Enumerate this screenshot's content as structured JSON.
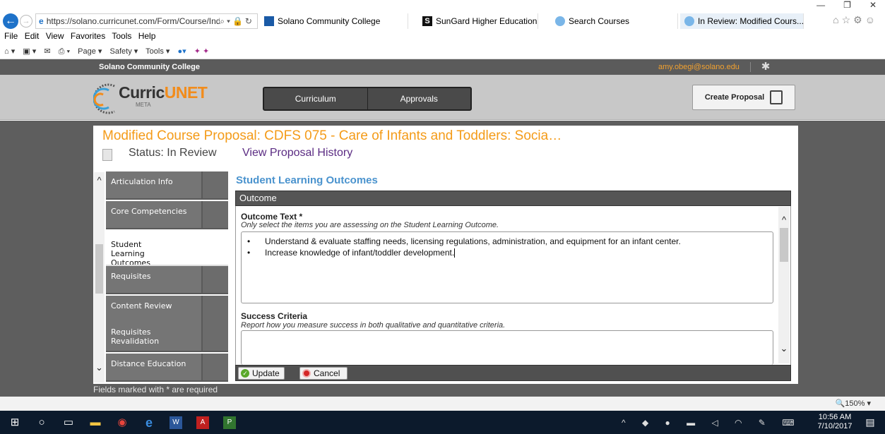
{
  "browser": {
    "url": "https://solano.curricunet.com/Form/Course/Inde:",
    "tabs": [
      {
        "label": "Solano Community College"
      },
      {
        "label": "SunGard Higher Education"
      },
      {
        "label": "Search Courses"
      },
      {
        "label": "In Review: Modified Cours..."
      }
    ],
    "menu": [
      "File",
      "Edit",
      "View",
      "Favorites",
      "Tools",
      "Help"
    ],
    "commands": [
      "Page ▾",
      "Safety ▾",
      "Tools ▾"
    ],
    "zoom": "150%",
    "tab_close": "×",
    "window_controls": [
      "—",
      "❐",
      "✕"
    ]
  },
  "site": {
    "college": "Solano Community College",
    "user_email": "amy.obegi@solano.edu",
    "logo": {
      "curric": "Curric",
      "unet": "UNET",
      "meta": "META"
    },
    "nav": [
      "Curriculum",
      "Approvals"
    ],
    "create_proposal": "Create Proposal"
  },
  "proposal": {
    "title": "Modified Course Proposal: CDFS 075 - Care of Infants and Toddlers: Socia…",
    "status": "Status: In Review",
    "history_link": "View Proposal History"
  },
  "sidebar": {
    "items": [
      {
        "label": "Articulation Info"
      },
      {
        "label": "Core Competencies"
      },
      {
        "label": "Student Learning Outcomes"
      },
      {
        "label": "Requisites"
      },
      {
        "label": "Content Review"
      },
      {
        "label": "Requisites Revalidation"
      },
      {
        "label": "Distance Education"
      }
    ],
    "active_index": 2
  },
  "main": {
    "section_title": "Student Learning Outcomes",
    "header": "Outcome",
    "outcome_label": "Outcome Text *",
    "outcome_help": "Only select the items you are assessing on the Student Learning Outcome.",
    "outcome_lines": [
      "Understand & evaluate staffing needs, licensing regulations, administration, and equipment for an infant center.",
      "Increase knowledge of infant/toddler development."
    ],
    "criteria_label": "Success Criteria",
    "criteria_help": "Report how you measure success in both qualitative and quantitative criteria.",
    "update_label": "Update",
    "cancel_label": "Cancel",
    "required_note": "Fields marked with * are required"
  },
  "taskbar": {
    "time": "10:56 AM",
    "date": "7/10/2017"
  },
  "colors": {
    "accent_orange": "#f49b18",
    "link_purple": "#5b2c83",
    "section_blue": "#4a93ce"
  }
}
